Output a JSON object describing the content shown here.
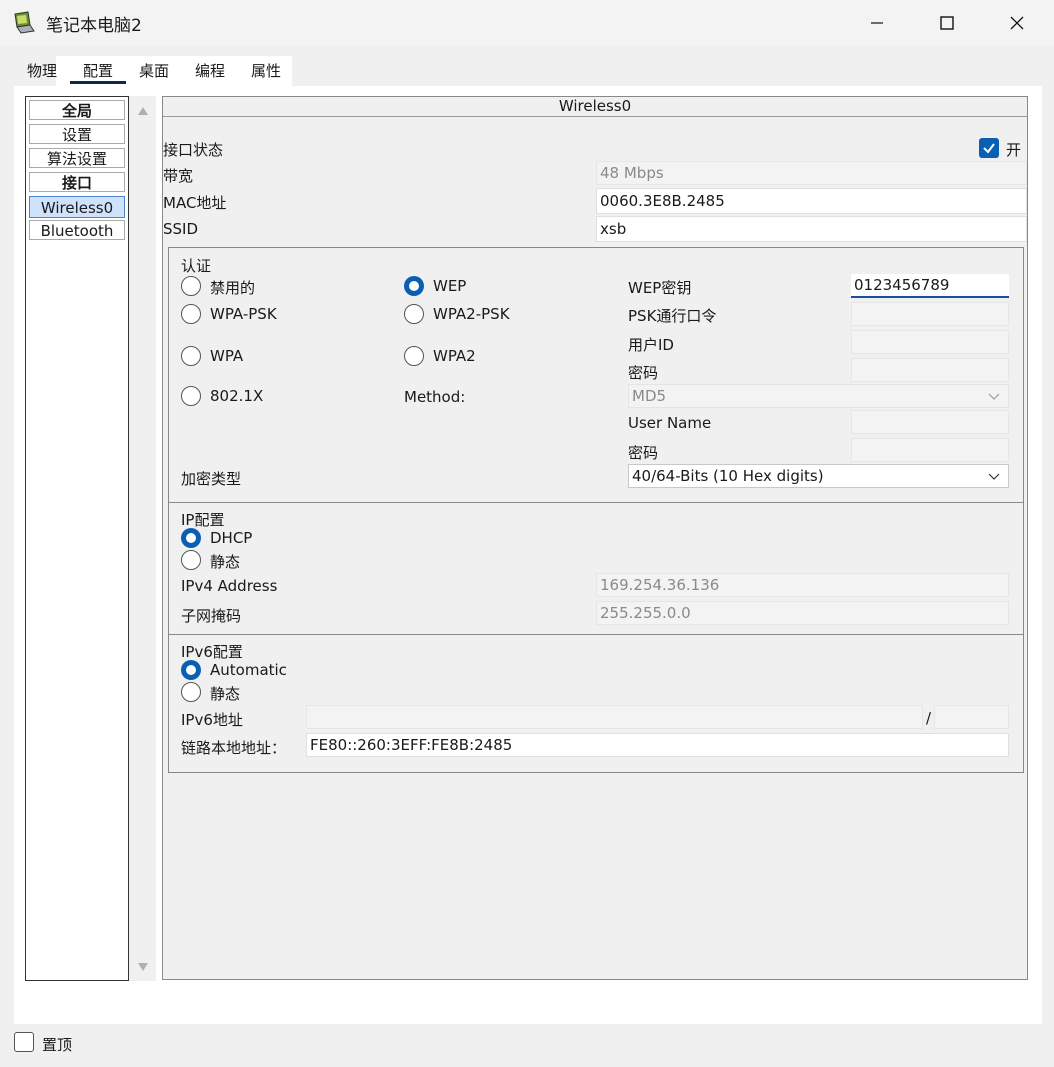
{
  "window": {
    "title": "笔记本电脑2",
    "icon": "laptop-app-icon",
    "buttons": [
      "minimize-icon",
      "maximize-icon",
      "close-icon"
    ]
  },
  "tabs": [
    "物理",
    "配置",
    "桌面",
    "编程",
    "属性"
  ],
  "active_tab": "配置",
  "sidebar": {
    "items": [
      "全局",
      "设置",
      "算法设置",
      "接口",
      "Wireless0",
      "Bluetooth"
    ],
    "selected": "Wireless0"
  },
  "panel": {
    "header": "Wireless0",
    "port_status_label": "接口状态",
    "port_on_label": "开",
    "port_on_checked": true,
    "bandwidth_label": "带宽",
    "bandwidth_value": "48 Mbps",
    "mac_label": "MAC地址",
    "mac_value": "0060.3E8B.2485",
    "ssid_label": "SSID",
    "ssid_value": "xsb"
  },
  "auth": {
    "title": "认证",
    "options": {
      "disabled": "禁用的",
      "wep": "WEP",
      "wpa_psk": "WPA-PSK",
      "wpa2_psk": "WPA2-PSK",
      "wpa": "WPA",
      "wpa2": "WPA2",
      "dot1x": "802.1X"
    },
    "selected": "WEP",
    "method_label": "Method:",
    "wep_key_label": "WEP密钥",
    "wep_key_value": "0123456789",
    "psk_label": "PSK通行口令",
    "user_id_label": "用户ID",
    "password_label": "密码",
    "method_value": "MD5",
    "user_name_label": "User Name",
    "password2_label": "密码",
    "encryption_label": "加密类型",
    "encryption_value": "40/64-Bits (10 Hex digits)"
  },
  "ip": {
    "title": "IP配置",
    "dhcp_label": "DHCP",
    "static_label": "静态",
    "selected": "DHCP",
    "ipv4_label": "IPv4 Address",
    "ipv4_value": "169.254.36.136",
    "mask_label": "子网掩码",
    "mask_value": "255.255.0.0"
  },
  "ipv6": {
    "title": "IPv6配置",
    "auto_label": "Automatic",
    "static_label": "静态",
    "selected": "Automatic",
    "addr_label": "IPv6地址",
    "addr_value": "",
    "slash": "/",
    "prefix_value": "",
    "link_local_label": "链路本地地址：",
    "link_local_value": "FE80::260:3EFF:FE8B:2485"
  },
  "footer": {
    "pin_label": "置顶",
    "pin_checked": false
  },
  "colors": {
    "accent": "#0a5fb4",
    "window_bg": "#f0f0f0",
    "tab_underline": "#0b2a4a",
    "selected_item_bg": "#cfe2fb"
  }
}
